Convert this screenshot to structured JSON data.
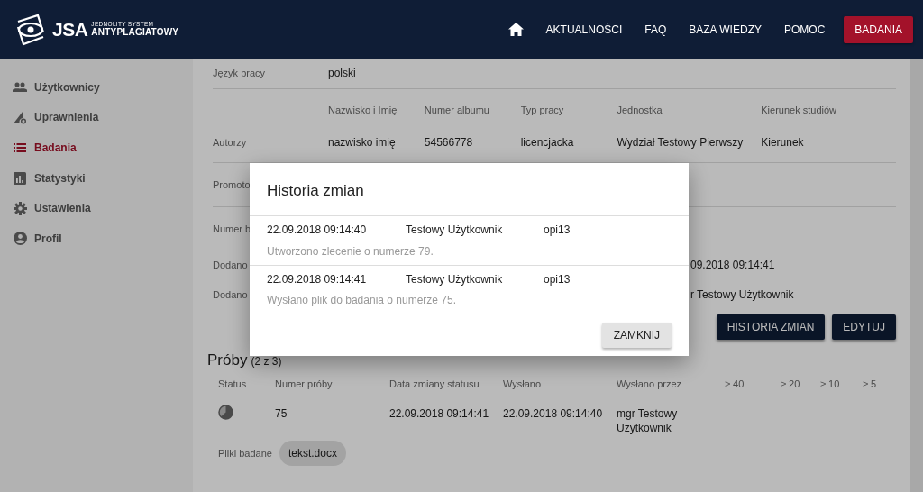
{
  "header": {
    "logo": {
      "abbr": "JSA",
      "line1": "JEDNOLITY SYSTEM",
      "line2": "ANTYPLAGIATOWY"
    },
    "nav_links": [
      "AKTUALNOŚCI",
      "FAQ",
      "BAZA WIEDZY",
      "POMOC"
    ],
    "primary_button": "BADANIA"
  },
  "sidebar": {
    "items": [
      {
        "label": "Użytkownicy",
        "kind": "users",
        "selected": false
      },
      {
        "label": "Uprawnienia",
        "kind": "permissions",
        "selected": false
      },
      {
        "label": "Badania",
        "kind": "list",
        "selected": true
      },
      {
        "label": "Statystyki",
        "kind": "stats",
        "selected": false
      },
      {
        "label": "Ustawienia",
        "kind": "settings",
        "selected": false
      },
      {
        "label": "Profil",
        "kind": "profile",
        "selected": false
      }
    ]
  },
  "details": {
    "language": {
      "label": "Język pracy",
      "value": "polski"
    },
    "authors": {
      "label": "Autorzy",
      "columns": [
        "Nazwisko i Imię",
        "Numer albumu",
        "Typ pracy",
        "Jednostka",
        "Kierunek studiów"
      ],
      "rows": [
        [
          "nazwisko imię",
          "54566778",
          "licencjacka",
          "Wydział Testowy Pierwszy",
          "Kierunek"
        ]
      ]
    },
    "partial_rows": [
      {
        "label": "Promoto"
      },
      {
        "label": "Numer b"
      },
      {
        "label": "Dodano",
        "value": "09.2018 09:14:41"
      },
      {
        "label": "Dodano",
        "value": "r Testowy Użytkownik"
      }
    ],
    "actions": [
      "HISTORIA ZMIAN",
      "EDYTUJ"
    ]
  },
  "samples": {
    "title": "Próby",
    "count": "(2 z 3)",
    "columns": [
      "Status",
      "Numer próby",
      "Data zmiany statusu",
      "Wysłano",
      "Wysłano przez",
      "≥ 40",
      "≥ 20",
      "≥ 10",
      "≥ 5"
    ],
    "rows": [
      {
        "cells": [
          "",
          "75",
          "22.09.2018 09:14:41",
          "22.09.2018 09:14:40",
          "mgr Testowy Użytkownik"
        ]
      }
    ],
    "files_label": "Pliki badane",
    "files": [
      "tekst.docx"
    ]
  },
  "modal": {
    "title": "Historia zmian",
    "entries": [
      {
        "date": "22.09.2018 09:14:40",
        "user": "Testowy Użytkownik",
        "login": "opi13",
        "description": "Utworzono zlecenie o numerze 79."
      },
      {
        "date": "22.09.2018 09:14:41",
        "user": "Testowy Użytkownik",
        "login": "opi13",
        "description": "Wysłano plik do badania o numerze 75."
      }
    ],
    "close_button": "ZAMKNIJ"
  }
}
